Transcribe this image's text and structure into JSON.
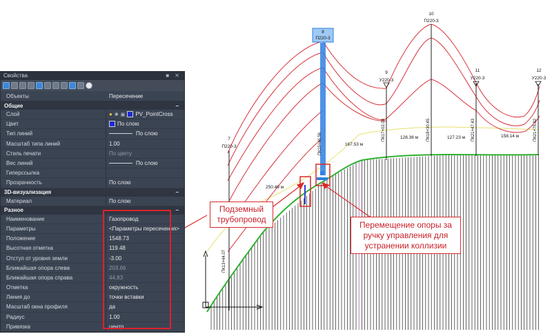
{
  "palette": {
    "title": "Свойства",
    "title_controls": "■ ✕",
    "objects_label": "Объекты",
    "objects_value": "Пересечение",
    "sections": {
      "general": "Общие",
      "viz3d": "3D-визуализация",
      "misc": "Разное",
      "collapse_glyph": "–"
    },
    "general_rows": {
      "layer_label": "Слой",
      "layer_value": "PV_PointCross",
      "color_label": "Цвет",
      "color_value": "По слою",
      "linetype_label": "Тип линий",
      "linetype_value": "По слою",
      "ltscale_label": "Масштаб типа линий",
      "ltscale_value": "1.00",
      "plotstyle_label": "Стиль печати",
      "plotstyle_value": "По цвету",
      "lineweight_label": "Вес линий",
      "lineweight_value": "По слою",
      "hyperlink_label": "Гиперссылка",
      "hyperlink_value": "",
      "transparency_label": "Прозрачность",
      "transparency_value": "По слою"
    },
    "viz_rows": {
      "material_label": "Материал",
      "material_value": "По слою"
    },
    "misc_rows": [
      {
        "label": "Наименование",
        "value": "Газопровод",
        "dim": false
      },
      {
        "label": "Параметры",
        "value": "<Параметры пересечения>",
        "dim": false
      },
      {
        "label": "Положение",
        "value": "1548.73",
        "dim": false
      },
      {
        "label": "Высотная отметка",
        "value": "119.48",
        "dim": false
      },
      {
        "label": "Отступ от уровня земли",
        "value": "-3.00",
        "dim": false
      },
      {
        "label": "Ближайшая опора слева",
        "value": "203.66",
        "dim": true
      },
      {
        "label": "Ближайшая опора справа",
        "value": "44.83",
        "dim": true
      },
      {
        "label": "Отметка",
        "value": "окружность",
        "dim": false
      },
      {
        "label": "Линия до",
        "value": "точки вставки",
        "dim": false
      },
      {
        "label": "Масштаб окна профиля",
        "value": "да",
        "dim": false
      },
      {
        "label": "Радиус",
        "value": "1.00",
        "dim": false
      },
      {
        "label": "Привязка",
        "value": "центр",
        "dim": false
      }
    ]
  },
  "callouts": {
    "underground": "Подземный трубопровод",
    "move_support": "Перемещение опоры за ручку управления для устранении коллизии"
  },
  "profile": {
    "supports": [
      {
        "num": "7",
        "type": "П220-3",
        "selected": false
      },
      {
        "num": "8",
        "type": "П220-3",
        "selected": true
      },
      {
        "num": "9",
        "type": "У220-3",
        "selected": false
      },
      {
        "num": "10",
        "type": "П220-3",
        "selected": false
      },
      {
        "num": "11",
        "type": "У220-3",
        "selected": false
      },
      {
        "num": "12",
        "type": "У220-3",
        "selected": false
      }
    ],
    "pk_labels": [
      "ПК13+44.07",
      "ПК15+46.56",
      "ПК17+02.09",
      "ПК18+30.45",
      "ПК21+47.43",
      "ПК21+75.82"
    ],
    "span_labels": [
      "250.49 м",
      "167.53 м",
      "128.36 м",
      "127.23 м",
      "158.14 м"
    ],
    "colors": {
      "wire": "#d8323a",
      "ground": "#30b030",
      "sag": "#e8e070",
      "selection": "#2f7fe0",
      "callout": "#d82a2a"
    }
  }
}
